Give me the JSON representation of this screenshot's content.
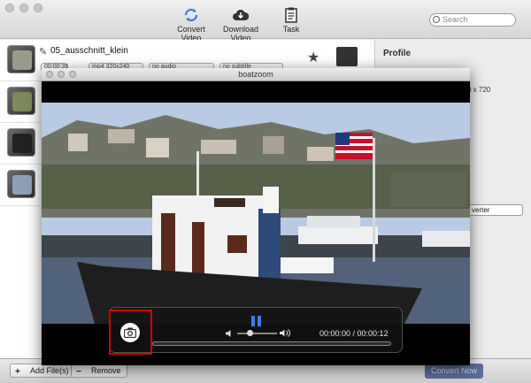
{
  "toolbar": {
    "convert_label": "Convert Video",
    "download_label": "Download Video",
    "task_label": "Task",
    "search_placeholder": "Search"
  },
  "file_list": {
    "first_file": {
      "name": "05_ausschnitt_klein",
      "duration": "00:00:35",
      "video": "mp4 320x240",
      "audio": "no audio",
      "subtitle": "no subtitle"
    }
  },
  "right_panel": {
    "profile_heading": "Profile",
    "resolution": "0 x 720",
    "converter": "verter"
  },
  "bottom": {
    "add_files": "Add File(s)",
    "remove": "Remove",
    "convert_now": "Convert Now"
  },
  "player": {
    "title": "boatzoom",
    "time": "00:00:00 / 00:00:12",
    "volume_level": 0.25,
    "progress": 0
  },
  "colors": {
    "accent_blue": "#3c7ee6",
    "highlight_red": "#d10000",
    "convert_button": "#5a6e9a"
  }
}
